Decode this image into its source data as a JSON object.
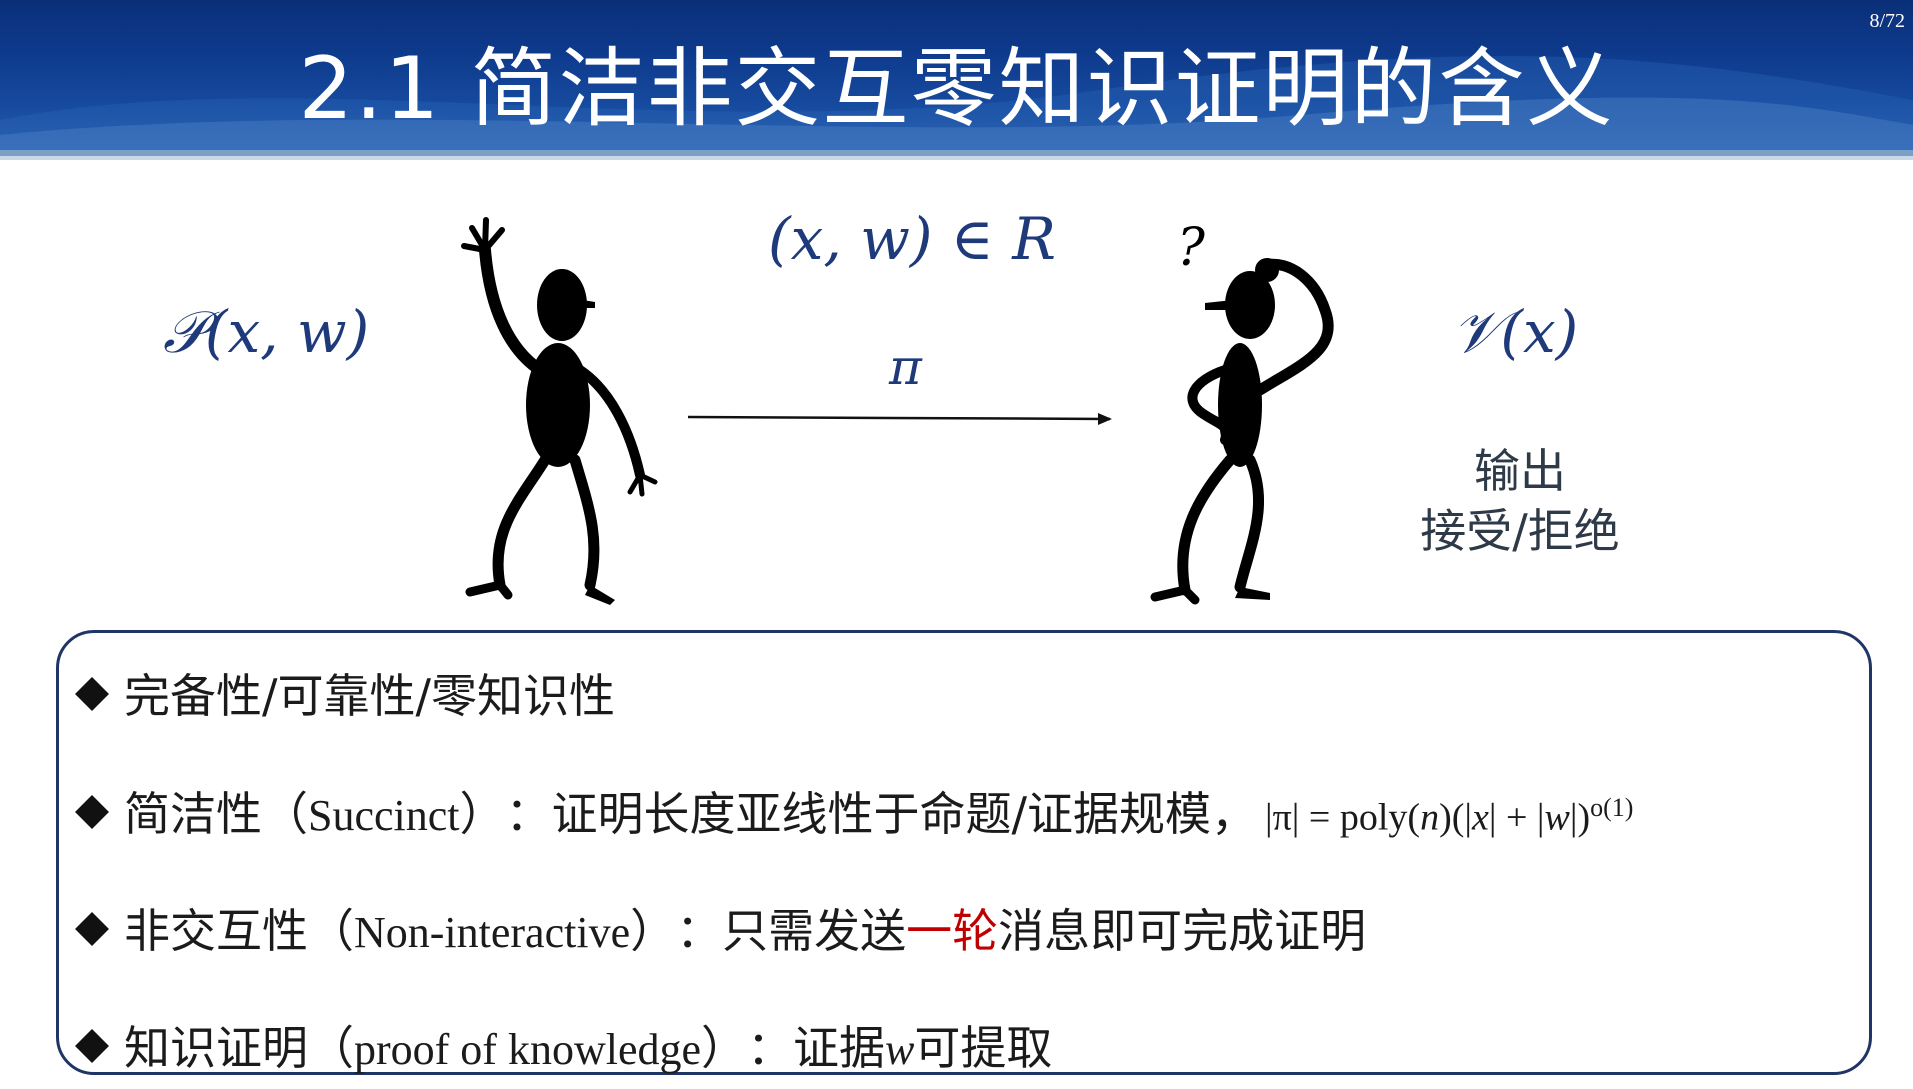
{
  "header": {
    "title": "2.1 简洁非交互零知识证明的含义",
    "page_number": "8/72",
    "background_color": "#0e3a8c"
  },
  "diagram": {
    "prover_label": "𝒫(x, w)",
    "relation": "(x, w) ∈ R",
    "proof_symbol": "π",
    "verifier_label": "𝒱(x)",
    "output_line1": "输出",
    "output_line2": "接受/拒绝",
    "prover_figure_icon": "waving-stick-figure",
    "verifier_figure_icon": "puzzled-stick-figure",
    "question_mark": "?"
  },
  "properties": {
    "item1": {
      "text": "完备性/可靠性/零知识性"
    },
    "item2": {
      "term": "简洁性",
      "open_paren": "（",
      "english": "Succinct",
      "close_paren": "）",
      "colon": "：",
      "desc": "证明长度亚线性于命题/证据规模，",
      "f_abs_pi": "|π| = poly(",
      "f_n": "n",
      "f_mid": ")(|",
      "f_x": "x",
      "f_plus": "| + |",
      "f_w": "w",
      "f_close": "|)",
      "f_exp": "o(1)"
    },
    "item3": {
      "term": "非交互性",
      "open_paren": "（",
      "english": "Non-interactive",
      "close_paren": "）",
      "colon": "：",
      "desc_before": "只需发送",
      "desc_highlight": "一轮",
      "desc_after": "消息即可完成证明",
      "highlight_color": "#c00000"
    },
    "item4": {
      "term": "知识证明",
      "open_paren": "（",
      "english": "proof of knowledge",
      "close_paren": "）",
      "colon": "：",
      "desc_before": "证据 ",
      "desc_var": "w",
      "desc_after": " 可提取"
    }
  }
}
